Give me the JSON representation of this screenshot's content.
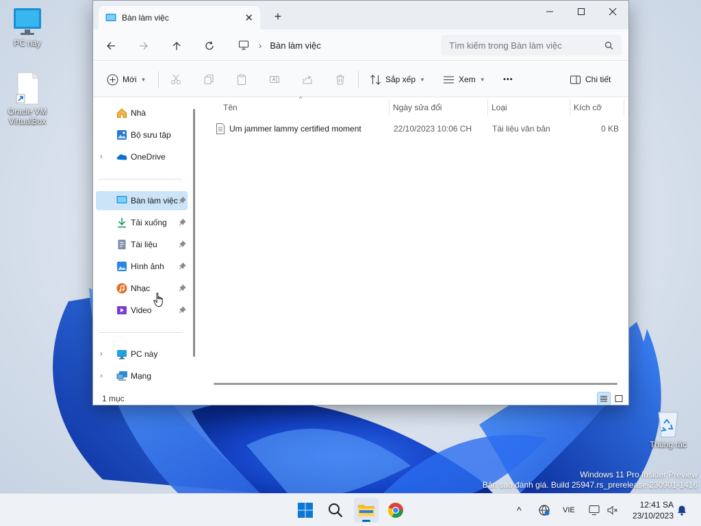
{
  "desktop": {
    "icons": [
      {
        "label": "PC này"
      },
      {
        "label": "Oracle VM VirtualBox"
      },
      {
        "label": "Thùng rác"
      }
    ],
    "watermark_line1": "Windows 11 Pro Insider Preview",
    "watermark_line2": "Bản sao đánh giá. Build 25947.rs_prerelease.230901-1416"
  },
  "window": {
    "tab_title": "Bàn làm việc",
    "tab_close": "✕",
    "new_tab": "+",
    "address_crumb": "Bàn làm việc",
    "search_placeholder": "Tìm kiếm trong Bàn làm việc",
    "toolbar": {
      "new_label": "Mới",
      "sort_label": "Sắp xếp",
      "view_label": "Xem",
      "more_label": "•••",
      "details_label": "Chi tiết"
    },
    "nav_pane": {
      "items": [
        {
          "label": "Nhà",
          "icon": "home-icon"
        },
        {
          "label": "Bộ sưu tập",
          "icon": "gallery-icon"
        },
        {
          "label": "OneDrive",
          "icon": "onedrive-icon"
        },
        {
          "label": "Bàn làm việc",
          "icon": "desktop-folder-icon"
        },
        {
          "label": "Tải xuống",
          "icon": "download-icon"
        },
        {
          "label": "Tài liệu",
          "icon": "documents-icon"
        },
        {
          "label": "Hình ảnh",
          "icon": "pictures-icon"
        },
        {
          "label": "Nhạc",
          "icon": "music-icon"
        },
        {
          "label": "Video",
          "icon": "video-icon"
        },
        {
          "label": "PC này",
          "icon": "pc-icon"
        },
        {
          "label": "Mạng",
          "icon": "network-icon"
        }
      ]
    },
    "columns": [
      "Tên",
      "Ngày sửa đổi",
      "Loại",
      "Kích cỡ"
    ],
    "files": [
      {
        "name": "Um jammer lammy certified moment",
        "modified": "22/10/2023 10:06 CH",
        "type": "Tài liệu văn bản",
        "size": "0 KB"
      }
    ],
    "status": "1 mục"
  },
  "taskbar": {
    "language": "VIE",
    "time": "12:41 SA",
    "date": "23/10/2023",
    "show_hidden": "^"
  },
  "colors": {
    "accent": "#0067c0",
    "selection": "#cce4f7"
  }
}
